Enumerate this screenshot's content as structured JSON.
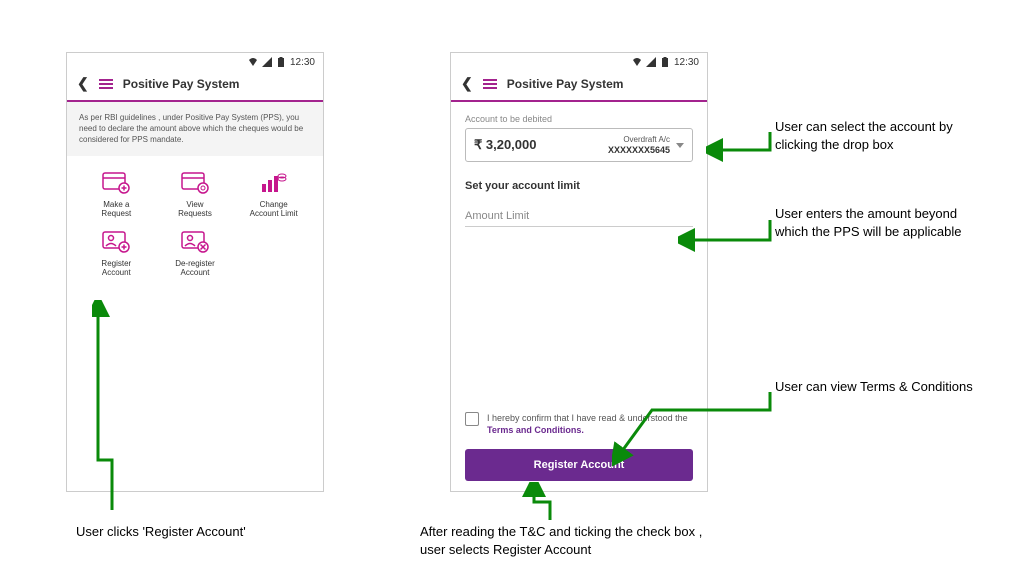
{
  "status": {
    "time": "12:30"
  },
  "header": {
    "title": "Positive Pay System"
  },
  "info_text": "As per RBI guidelines , under Positive Pay System (PPS), you need to declare the amount above which the cheques would be considered for PPS mandate.",
  "grid": {
    "make_request": "Make a\nRequest",
    "view_requests": "View\nRequests",
    "change_limit": "Change\nAccount Limit",
    "register": "Register\nAccount",
    "deregister": "De-register\nAccount"
  },
  "form": {
    "account_label": "Account to be debited",
    "amount": "₹ 3,20,000",
    "account_type": "Overdraft A/c",
    "account_no": "XXXXXXX5645",
    "limit_title": "Set your account limit",
    "limit_placeholder": "Amount Limit",
    "confirm_prefix": "I hereby confirm that I have read & understood the ",
    "tc_text": "Terms and Conditions.",
    "cta": "Register Account"
  },
  "annotations": {
    "a1": "User clicks 'Register Account'",
    "a2": "After reading the T&C and ticking the check box , user selects Register Account",
    "a3": "User can select the account by clicking the drop box",
    "a4": "User enters the amount beyond which the PPS will be applicable",
    "a5": "User can view Terms & Conditions"
  }
}
